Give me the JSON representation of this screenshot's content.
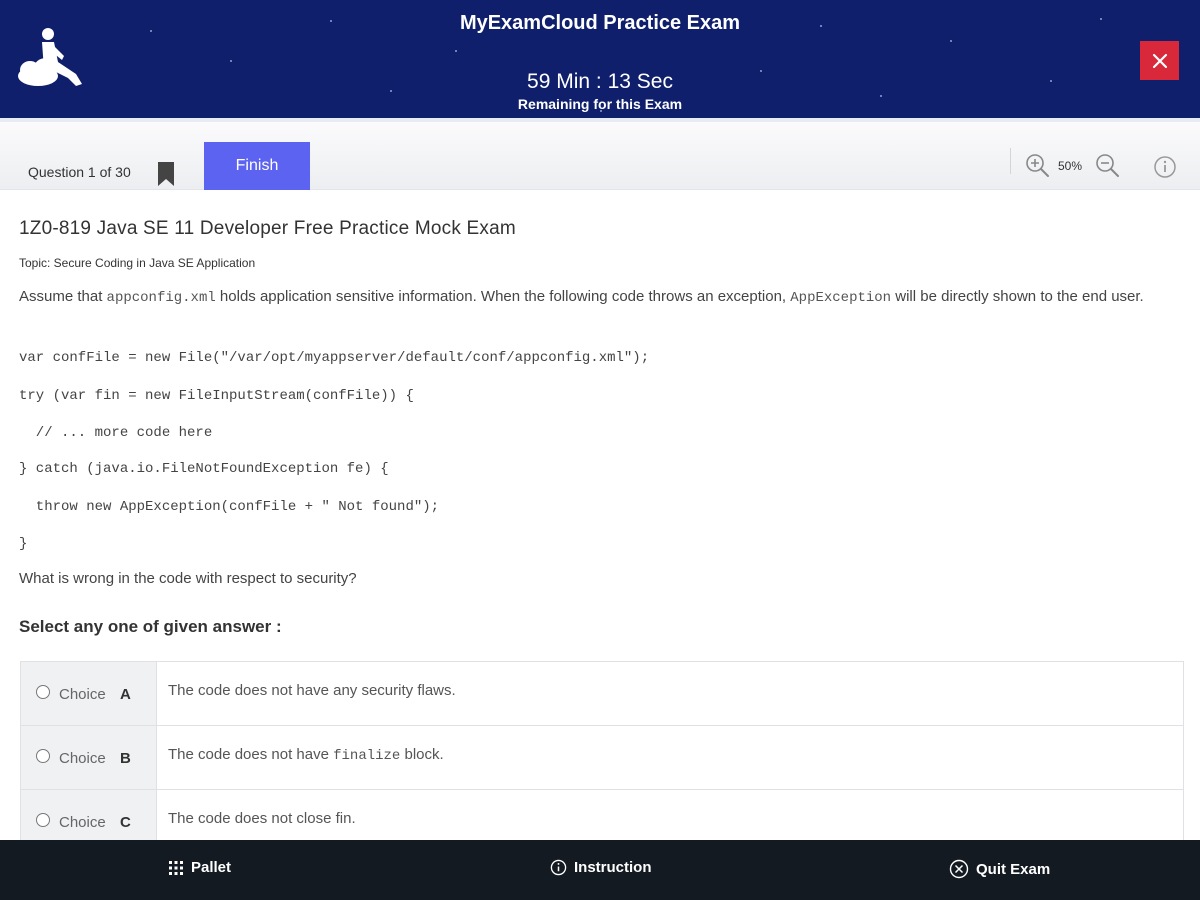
{
  "header": {
    "title": "MyExamCloud Practice Exam",
    "timer": "59 Min : 13 Sec",
    "timer_caption": "Remaining for this Exam",
    "close_icon": "close-icon"
  },
  "toolbar": {
    "question_counter": "Question 1 of 30",
    "finish_label": "Finish",
    "zoom_level": "50%",
    "icons": [
      "bookmark-icon",
      "zoom-in-icon",
      "zoom-out-icon",
      "info-icon"
    ]
  },
  "question": {
    "exam_title": "1Z0-819 Java SE 11 Developer Free Practice Mock Exam",
    "topic": "Topic: Secure Coding in Java SE Application",
    "intro_part1": "Assume that ",
    "intro_code1": "appconfig.xml",
    "intro_part2": " holds application sensitive information. When the following code throws an exception, ",
    "intro_code2": "AppException",
    "intro_part3": " will be directly shown to the end user.",
    "code_lines": [
      "var confFile = new File(\"/var/opt/myappserver/default/conf/appconfig.xml\");",
      "try (var fin = new FileInputStream(confFile)) {",
      "  // ... more code here",
      "} catch (java.io.FileNotFoundException fe) {",
      "  throw new AppException(confFile + \" Not found\");",
      "}"
    ],
    "ask": "What is wrong in the code with respect to security?",
    "select_label": "Select any one of given answer :"
  },
  "choices": [
    {
      "word": "Choice",
      "letter": "A",
      "text_before": "The code does not have any security flaws.",
      "text_code": "",
      "text_after": ""
    },
    {
      "word": "Choice",
      "letter": "B",
      "text_before": "The code does not have ",
      "text_code": "finalize",
      "text_after": " block."
    },
    {
      "word": "Choice",
      "letter": "C",
      "text_before": "The code does not close fin.",
      "text_code": "",
      "text_after": ""
    }
  ],
  "bottom_bar": {
    "pallet_label": "Pallet",
    "instruction_label": "Instruction",
    "quit_label": "Quit Exam",
    "icons": [
      "grid-icon",
      "info-icon",
      "close-circle-icon"
    ]
  },
  "colors": {
    "header_bg": "#0f1f6b",
    "finish_button": "#5b63f0",
    "close_button": "#d8283a",
    "bottom_bar": "#141a22"
  }
}
